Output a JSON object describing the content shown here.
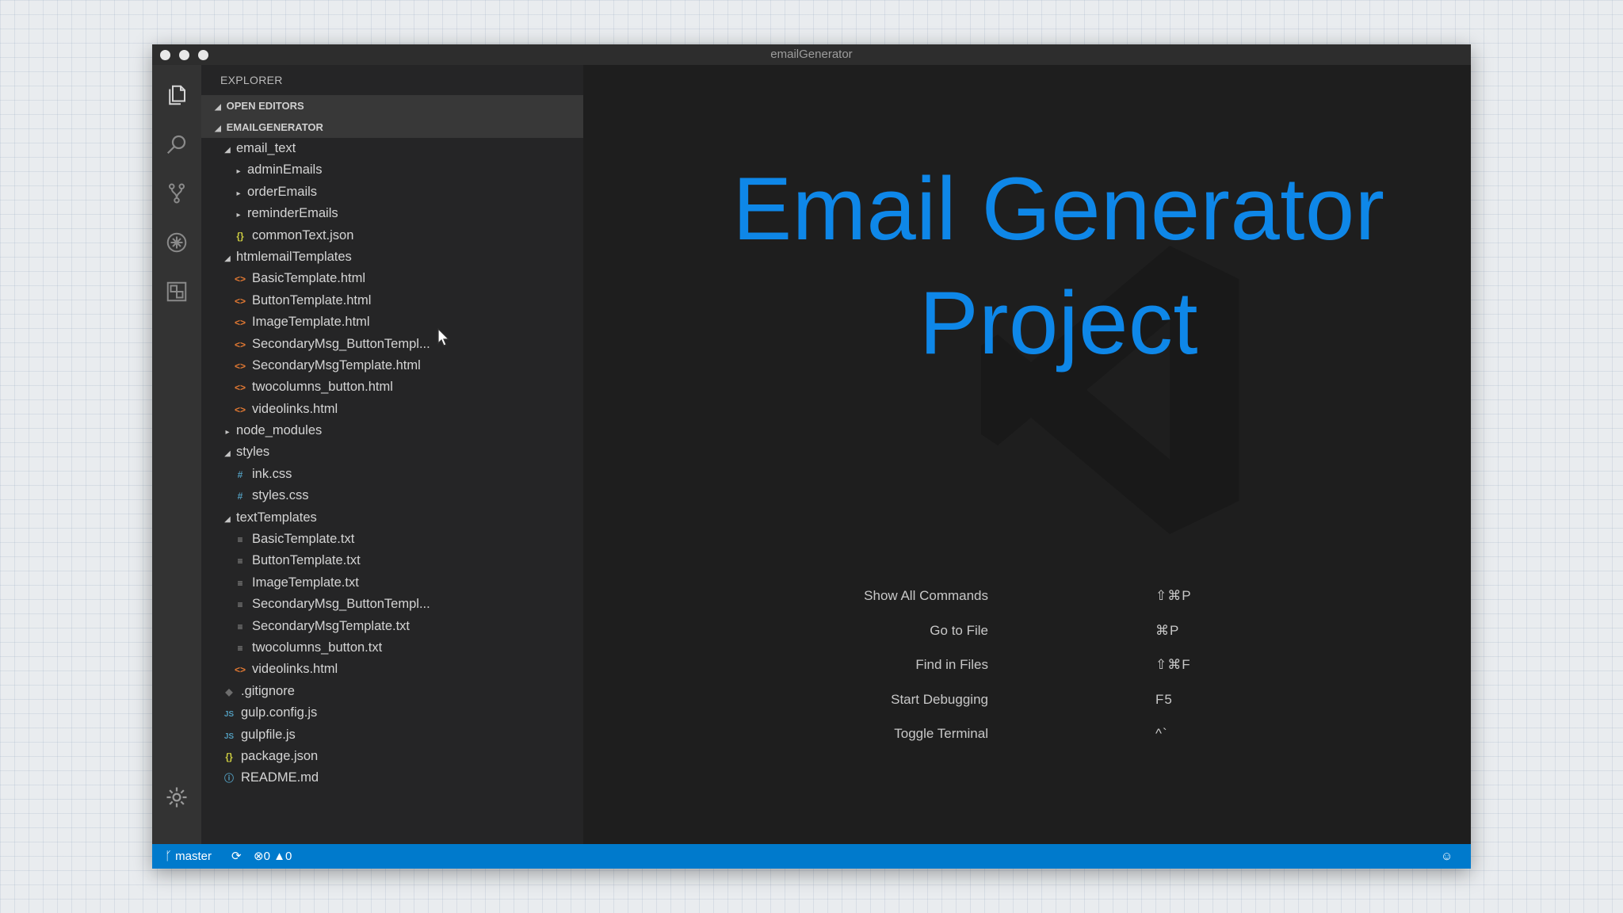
{
  "window": {
    "title": "emailGenerator"
  },
  "sidebar": {
    "header": "EXPLORER",
    "sections": {
      "open_editors": "OPEN EDITORS",
      "project": "EMAILGENERATOR"
    },
    "tree": [
      {
        "label": "email_text",
        "depth": 1,
        "kind": "folder",
        "open": true
      },
      {
        "label": "adminEmails",
        "depth": 2,
        "kind": "folder",
        "open": false
      },
      {
        "label": "orderEmails",
        "depth": 2,
        "kind": "folder",
        "open": false
      },
      {
        "label": "reminderEmails",
        "depth": 2,
        "kind": "folder",
        "open": false
      },
      {
        "label": "commonText.json",
        "depth": 2,
        "kind": "json"
      },
      {
        "label": "htmlemailTemplates",
        "depth": 1,
        "kind": "folder",
        "open": true
      },
      {
        "label": "BasicTemplate.html",
        "depth": 2,
        "kind": "html"
      },
      {
        "label": "ButtonTemplate.html",
        "depth": 2,
        "kind": "html"
      },
      {
        "label": "ImageTemplate.html",
        "depth": 2,
        "kind": "html"
      },
      {
        "label": "SecondaryMsg_ButtonTempl...",
        "depth": 2,
        "kind": "html"
      },
      {
        "label": "SecondaryMsgTemplate.html",
        "depth": 2,
        "kind": "html"
      },
      {
        "label": "twocolumns_button.html",
        "depth": 2,
        "kind": "html"
      },
      {
        "label": "videolinks.html",
        "depth": 2,
        "kind": "html"
      },
      {
        "label": "node_modules",
        "depth": 1,
        "kind": "folder",
        "open": false
      },
      {
        "label": "styles",
        "depth": 1,
        "kind": "folder",
        "open": true
      },
      {
        "label": "ink.css",
        "depth": 2,
        "kind": "css"
      },
      {
        "label": "styles.css",
        "depth": 2,
        "kind": "css"
      },
      {
        "label": "textTemplates",
        "depth": 1,
        "kind": "folder",
        "open": true
      },
      {
        "label": "BasicTemplate.txt",
        "depth": 2,
        "kind": "txt"
      },
      {
        "label": "ButtonTemplate.txt",
        "depth": 2,
        "kind": "txt"
      },
      {
        "label": "ImageTemplate.txt",
        "depth": 2,
        "kind": "txt"
      },
      {
        "label": "SecondaryMsg_ButtonTempl...",
        "depth": 2,
        "kind": "txt"
      },
      {
        "label": "SecondaryMsgTemplate.txt",
        "depth": 2,
        "kind": "txt"
      },
      {
        "label": "twocolumns_button.txt",
        "depth": 2,
        "kind": "txt"
      },
      {
        "label": "videolinks.html",
        "depth": 2,
        "kind": "html"
      },
      {
        "label": ".gitignore",
        "depth": 1,
        "kind": "git"
      },
      {
        "label": "gulp.config.js",
        "depth": 1,
        "kind": "js"
      },
      {
        "label": "gulpfile.js",
        "depth": 1,
        "kind": "js"
      },
      {
        "label": "package.json",
        "depth": 1,
        "kind": "json"
      },
      {
        "label": "README.md",
        "depth": 1,
        "kind": "info"
      }
    ]
  },
  "activity_icons": [
    "files-icon",
    "search-icon",
    "source-control-icon",
    "debug-icon",
    "extensions-icon",
    "settings-gear-icon"
  ],
  "editor": {
    "welcome_line1": "Email Generator",
    "welcome_line2": "Project",
    "shortcuts": [
      {
        "label": "Show All Commands",
        "keys": "⇧⌘P"
      },
      {
        "label": "Go to File",
        "keys": "⌘P"
      },
      {
        "label": "Find in Files",
        "keys": "⇧⌘F"
      },
      {
        "label": "Start Debugging",
        "keys": "F5"
      },
      {
        "label": "Toggle Terminal",
        "keys": "^`"
      }
    ]
  },
  "statusbar": {
    "branch": "master",
    "errors": "0",
    "warnings": "0"
  },
  "colors": {
    "accent": "#007acc",
    "welcome_text": "#0e87e8",
    "sidebar_bg": "#252526",
    "editor_bg": "#1e1e1e"
  }
}
